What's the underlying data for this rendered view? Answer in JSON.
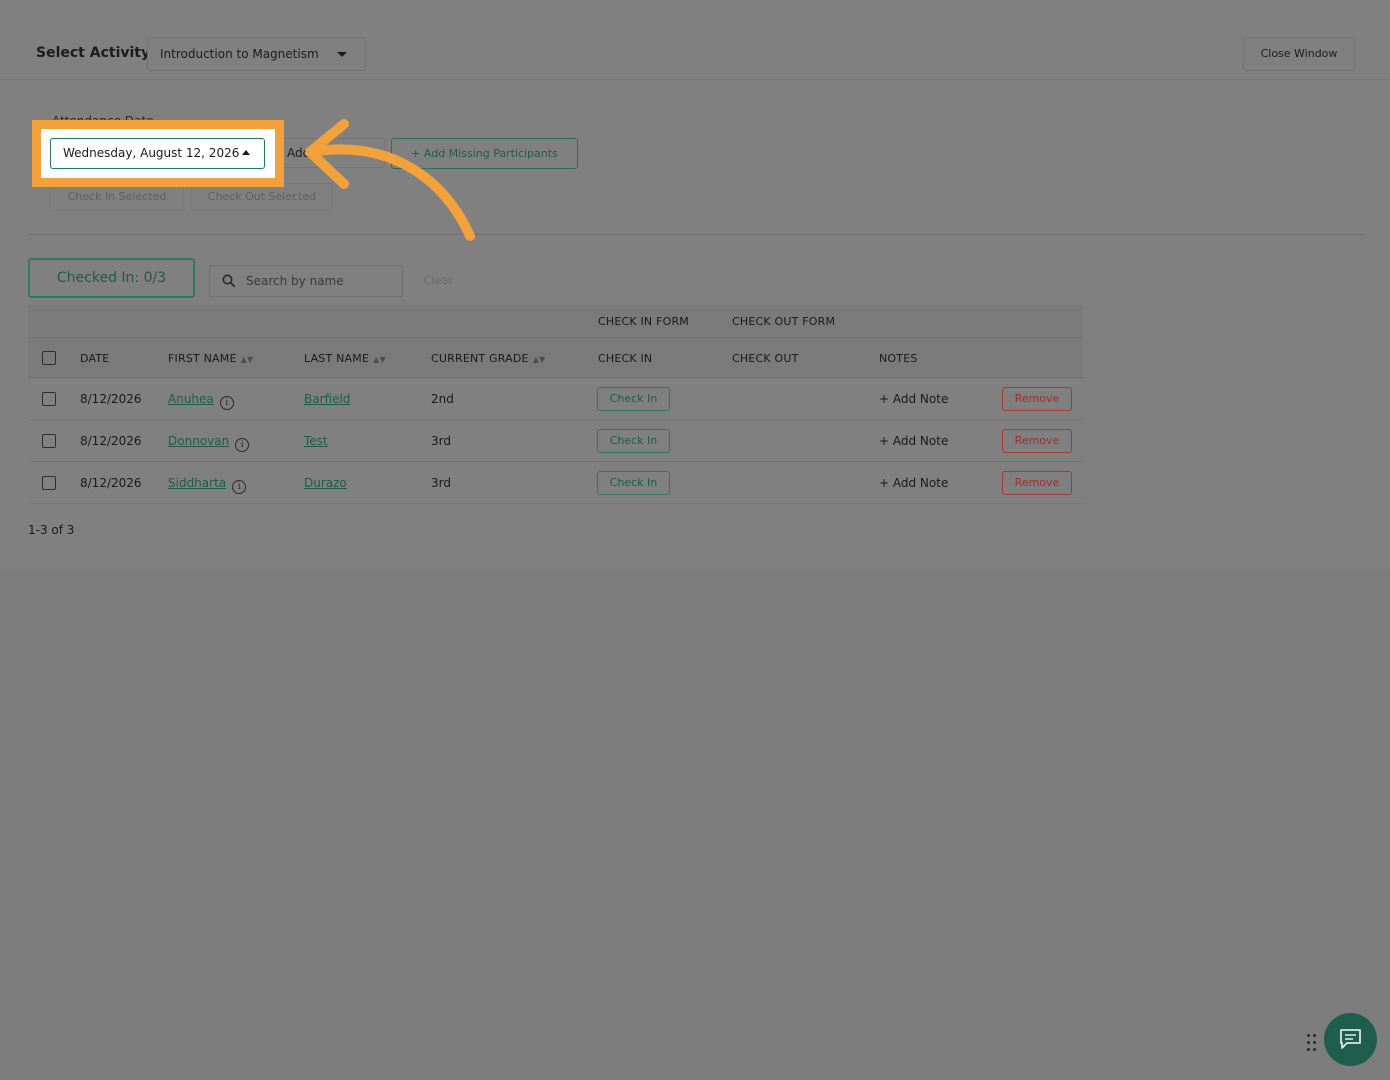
{
  "header": {
    "activity_label": "Select Activity:",
    "activity_value": "Introduction to Magnetism",
    "close_button": "Close Window"
  },
  "attendance": {
    "date_label": "Attendance Date",
    "date_value": "Wednesday, August 12, 2026",
    "add_partial": "Add",
    "add_missing": "+ Add Missing Participants",
    "check_in_selected": "Check In Selected",
    "check_out_selected": "Check Out Selected"
  },
  "filters": {
    "checked_in": "Checked In: 0/3",
    "search_placeholder": "Search by name",
    "clear": "Clear"
  },
  "table": {
    "group_headers": {
      "check_in_form": "CHECK IN FORM",
      "check_out_form": "CHECK OUT FORM"
    },
    "columns": {
      "date": "DATE",
      "first_name": "FIRST NAME",
      "last_name": "LAST NAME",
      "current_grade": "CURRENT GRADE",
      "check_in": "CHECK IN",
      "check_out": "CHECK OUT",
      "notes": "NOTES"
    },
    "sort_glyph": "▲▼",
    "rows": [
      {
        "date": "8/12/2026",
        "first_name": "Anuhea",
        "last_name": "Barfield",
        "grade": "2nd",
        "check_in": "Check In",
        "note": "+ Add Note",
        "remove": "Remove"
      },
      {
        "date": "8/12/2026",
        "first_name": "Donnovan",
        "last_name": "Test",
        "grade": "3rd",
        "check_in": "Check In",
        "note": "+ Add Note",
        "remove": "Remove"
      },
      {
        "date": "8/12/2026",
        "first_name": "Siddharta",
        "last_name": "Durazo",
        "grade": "3rd",
        "check_in": "Check In",
        "note": "+ Add Note",
        "remove": "Remove"
      }
    ],
    "pagination": "1-3 of 3"
  },
  "icons": {
    "search": "search-icon",
    "info": "info-icon",
    "chat": "chat-icon",
    "drag": "drag-handle-icon",
    "arrow": "annotation-arrow"
  },
  "colors": {
    "overlay_gray": "#808080",
    "accent_green": "#1e5e4b",
    "highlight_orange": "#f2a13c",
    "remove_red": "#9c2f2f"
  }
}
